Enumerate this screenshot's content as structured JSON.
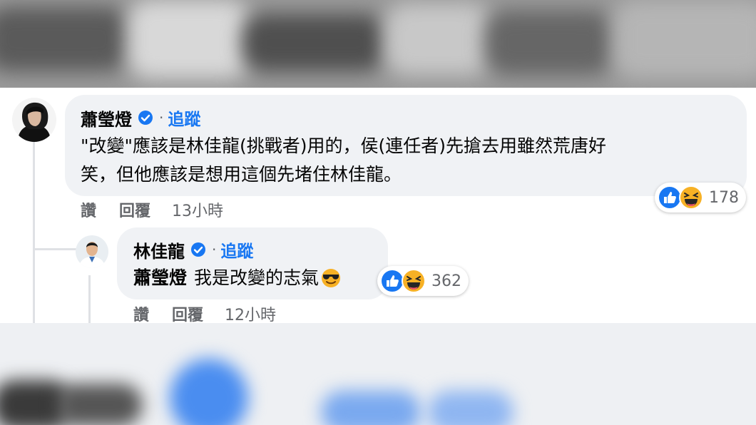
{
  "comment": {
    "author": "蕭瑩燈",
    "separator": "·",
    "follow_label": "追蹤",
    "text_line1": "\"改變\"應該是林佳龍(挑戰者)用的，侯(連任者)先搶去用雖然荒唐好",
    "text_line2": "笑，但他應該是想用這個先堵住林佳龍。",
    "reaction_count": "178",
    "reaction_icons": [
      "like-icon",
      "haha-icon"
    ],
    "like_label": "讚",
    "reply_label": "回覆",
    "timestamp": "13小時"
  },
  "reply": {
    "author": "林佳龍",
    "separator": "·",
    "follow_label": "追蹤",
    "mention": "蕭瑩燈",
    "text": "我是改變的志氣",
    "text_emoji": "sunglasses-emoji",
    "reaction_count": "362",
    "reaction_icons": [
      "like-icon",
      "haha-icon"
    ],
    "like_label": "讚",
    "reply_label": "回覆",
    "timestamp": "12小時"
  },
  "colors": {
    "bubble": "#f0f2f5",
    "link_blue": "#1877f2",
    "meta_gray": "#65676b"
  }
}
